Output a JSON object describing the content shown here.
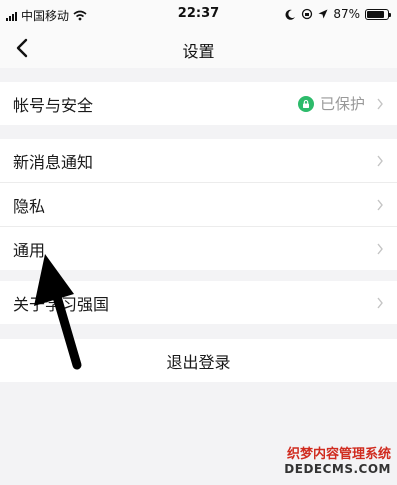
{
  "status_bar": {
    "carrier": "中国移动",
    "time": "22:37",
    "battery_percent": "87%",
    "battery_level": 0.87
  },
  "nav": {
    "title": "设置",
    "back_icon": "chevron-left-icon"
  },
  "groups": [
    {
      "items": [
        {
          "label": "帐号与安全",
          "value": "已保护",
          "value_icon": "lock-icon",
          "value_color": "#2dbb6b"
        }
      ]
    },
    {
      "items": [
        {
          "label": "新消息通知"
        },
        {
          "label": "隐私"
        },
        {
          "label": "通用"
        }
      ]
    },
    {
      "items": [
        {
          "label": "关于学习强国"
        }
      ]
    }
  ],
  "logout": {
    "label": "退出登录"
  },
  "annotation": {
    "icon": "arrow-pointer-icon",
    "target": "通用"
  },
  "watermark": {
    "line1": "织梦内容管理系统",
    "line2": "DEDECMS.COM"
  }
}
